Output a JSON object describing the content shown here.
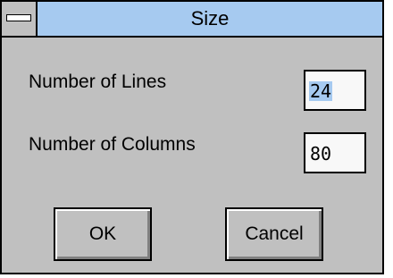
{
  "window": {
    "title": "Size"
  },
  "form": {
    "lines_label": "Number of Lines",
    "lines_value": "24",
    "columns_label": "Number of Columns",
    "columns_value": "80"
  },
  "buttons": {
    "ok_label": "OK",
    "cancel_label": "Cancel"
  },
  "colors": {
    "title_bar": "#a6caf0",
    "dialog_face": "#c0c0c0",
    "selection": "#a6caf0"
  }
}
